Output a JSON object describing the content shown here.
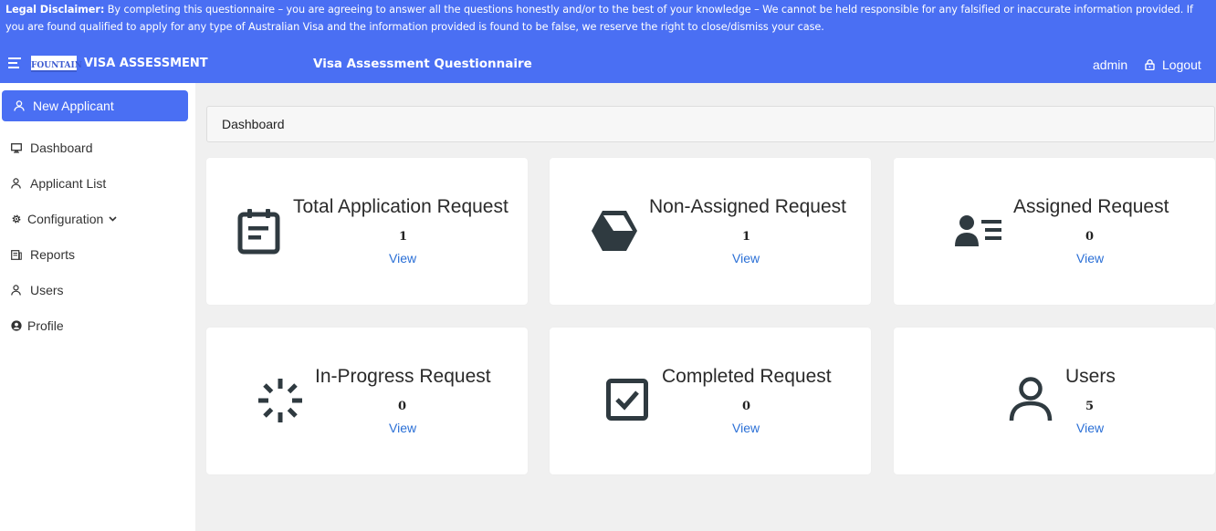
{
  "disclaimer": {
    "label": "Legal Disclaimer:",
    "text": " By completing this questionnaire – you are agreeing to answer all the questions honestly and/or to the best of your knowledge – We cannot be held responsible for any falsified or inaccurate information provided. If you are found qualified to apply for any type of Australian Visa and the information provided is found to be false, we reserve the right to close/dismiss your case."
  },
  "header": {
    "logo_text": "FOUNTAIN",
    "brand": "VISA ASSESSMENT",
    "page_title": "Visa Assessment Questionnaire",
    "user": "admin",
    "logout": "Logout"
  },
  "sidebar": {
    "new_applicant": "New Applicant",
    "items": [
      {
        "label": "Dashboard",
        "icon": "monitor-icon"
      },
      {
        "label": "Applicant List",
        "icon": "user-icon"
      },
      {
        "label": "Configuration",
        "icon": "gear-icon"
      },
      {
        "label": "Reports",
        "icon": "report-icon"
      },
      {
        "label": "Users",
        "icon": "user-icon"
      },
      {
        "label": "Profile",
        "icon": "profile-circle-icon"
      }
    ]
  },
  "breadcrumb": "Dashboard",
  "cards": [
    {
      "title": "Total Application Request",
      "count": "1",
      "view": "View",
      "icon": "calendar-icon"
    },
    {
      "title": "Non-Assigned Request",
      "count": "1",
      "view": "View",
      "icon": "hexagon-box-icon"
    },
    {
      "title": "Assigned Request",
      "count": "0",
      "view": "View",
      "icon": "user-list-icon"
    },
    {
      "title": "In-Progress Request",
      "count": "0",
      "view": "View",
      "icon": "spinner-icon"
    },
    {
      "title": "Completed Request",
      "count": "0",
      "view": "View",
      "icon": "checkbox-icon"
    },
    {
      "title": "Users",
      "count": "5",
      "view": "View",
      "icon": "user-outline-icon"
    }
  ],
  "colors": {
    "accent": "#4a6ff3",
    "link": "#2a6fd6",
    "icon": "#2f3a40"
  }
}
